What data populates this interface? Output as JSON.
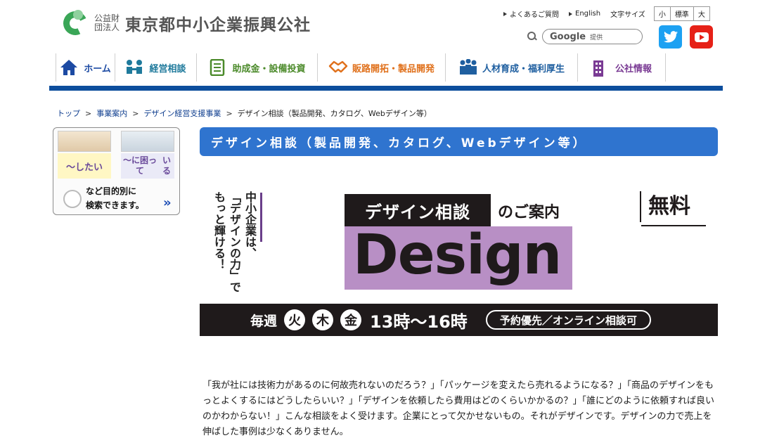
{
  "header": {
    "logo_small": "公益財団法人",
    "logo_name": "東京都中小企業振興公社",
    "util_links": [
      "よくあるご質問",
      "English"
    ],
    "font_size_label": "文字サイズ",
    "font_sizes": [
      "小",
      "標準",
      "大"
    ],
    "search_google": "Google",
    "search_provider": "提供"
  },
  "social": [
    "twitter-icon",
    "youtube-icon"
  ],
  "nav": [
    {
      "label": "ホーム",
      "icon": "home-icon",
      "color": "#1c4aa3",
      "width": 84
    },
    {
      "label": "経営相談",
      "icon": "consult-icon",
      "color": "#1f7a9c",
      "width": 116
    },
    {
      "label": "助成金・設備投資",
      "icon": "document-icon",
      "color": "#4b8a2a",
      "width": 172
    },
    {
      "label": "販路開拓・製品開発",
      "icon": "handshake-icon",
      "color": "#e0711c",
      "width": 182
    },
    {
      "label": "人材育成・福利厚生",
      "icon": "people-icon",
      "color": "#1f5fa0",
      "width": 188
    },
    {
      "label": "公社情報",
      "icon": "building-icon",
      "color": "#7a3b94",
      "width": 126
    }
  ],
  "breadcrumb": {
    "links": [
      "トップ",
      "事業案内",
      "デザイン経営支援事業"
    ],
    "current": "デザイン相談（製品開発、カタログ、Webデザイン等）"
  },
  "side_banner": {
    "bubble1": "〜したい",
    "bubble2_line1": "〜に困って",
    "bubble2_line2": "いる",
    "text_line1": "など目的別に",
    "text_line2": "検索できます。",
    "arrow": "»"
  },
  "page_title": "デザイン相談（製品開発、カタログ、Webデザイン等）",
  "hero": {
    "vertical_line1": "中小企業は、",
    "vertical_line2": "「デザインの力」で",
    "vertical_line3": "もっと輝ける！",
    "label": "デザイン相談",
    "label_suffix": "のご案内",
    "design_word": "Design",
    "free": "無料",
    "weekly": "毎週",
    "days": [
      "火",
      "木",
      "金"
    ],
    "hours": "13時〜16時",
    "reservation": "予約優先／オンライン相談可"
  },
  "body_text": "「我が社には技術力があるのに何故売れないのだろう？」「パッケージを変えたら売れるようになる？」「商品のデザインをもっとよくするにはどうしたらいい？」「デザインを依頼したら費用はどのくらいかかるの？」「誰にどのように依頼すれば良いのかわからない！」こんな相談をよく受けます。企業にとって欠かせないもの。それがデザインです。デザインの力で売上を伸ばした事例は少なくありません。"
}
